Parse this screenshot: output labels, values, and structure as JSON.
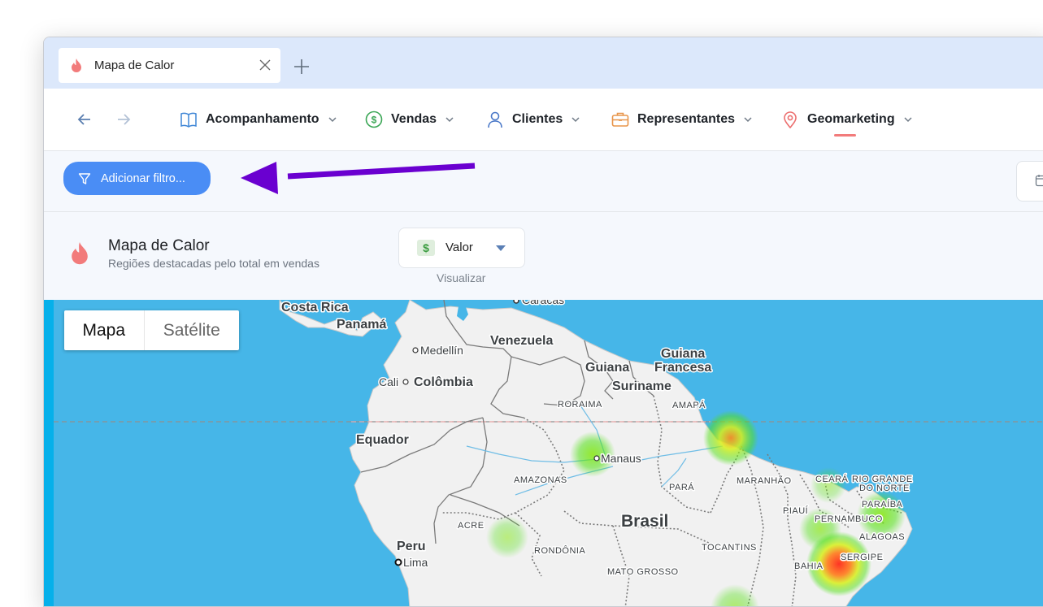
{
  "tab": {
    "title": "Mapa de Calor",
    "icon": "flame-icon"
  },
  "nav": {
    "menu": [
      {
        "label": "Acompanhamento",
        "icon": "book-icon"
      },
      {
        "label": "Vendas",
        "icon": "dollar-circle-icon"
      },
      {
        "label": "Clientes",
        "icon": "user-icon"
      },
      {
        "label": "Representantes",
        "icon": "briefcase-icon"
      },
      {
        "label": "Geomarketing",
        "icon": "map-pin-icon",
        "active": true
      }
    ]
  },
  "filter": {
    "label": "Adicionar filtro..."
  },
  "header": {
    "title": "Mapa de Calor",
    "subtitle": "Regiões destacadas pelo total em vendas",
    "select_value": "Valor",
    "select_caption": "Visualizar"
  },
  "map": {
    "toggle": {
      "map_label": "Mapa",
      "satellite_label": "Satélite",
      "selected": "Mapa"
    },
    "labels": {
      "costa_rica": "Costa Rica",
      "panama": "Panamá",
      "caracas": "Caracas",
      "venezuela": "Venezuela",
      "medellin": "Medellín",
      "guiana": "Guiana",
      "guiana_francesa_1": "Guiana",
      "guiana_francesa_2": "Francesa",
      "suriname": "Suriname",
      "cali": "Cali",
      "colombia": "Colômbia",
      "roraima": "RORAIMA",
      "amapa": "AMAPÁ",
      "equador": "Equador",
      "manaus": "Manaus",
      "amazonas": "AMAZONAS",
      "para": "PARÁ",
      "maranhao": "MARANHÃO",
      "ceara": "CEARÁ",
      "rio_grande_1": "RIO GRANDE",
      "rio_grande_2": "DO NORTE",
      "paraiba": "PARAÍBA",
      "piaui": "PIAUÍ",
      "pernambuco": "PERNAMBUCO",
      "alagoas": "ALAGOAS",
      "sergipe": "SERGIPE",
      "bahia": "BAHIA",
      "acre": "ACRE",
      "brasil": "Brasil",
      "peru": "Peru",
      "lima": "Lima",
      "rondonia": "RONDÔNIA",
      "tocantins": "TOCANTINS",
      "mato_grosso": "MATO GROSSO"
    }
  },
  "colors": {
    "primary": "#4a8df5",
    "accent_flame": "#f27b7b",
    "ocean": "#46b6e8",
    "land": "#f1f1f1",
    "annotation_arrow": "#6a00d0"
  }
}
